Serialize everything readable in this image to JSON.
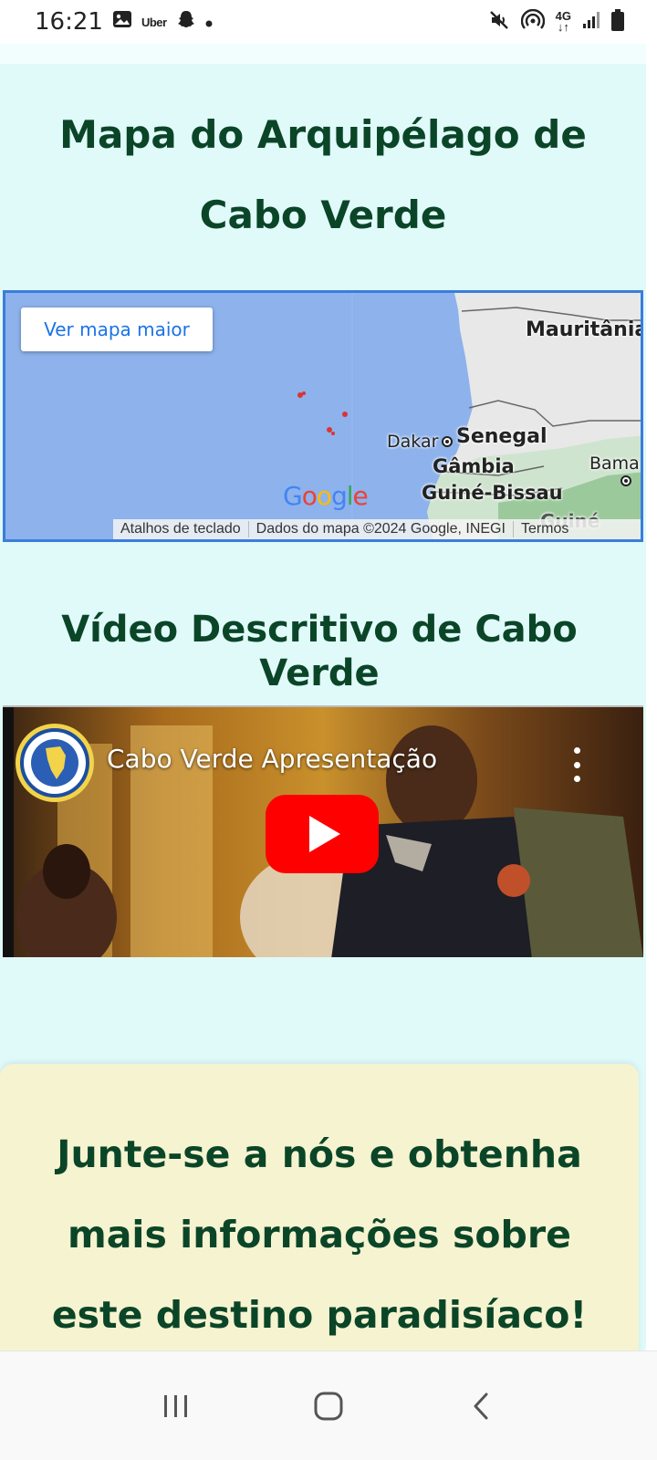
{
  "status_bar": {
    "time": "16:21",
    "left_icons": [
      "image-icon",
      "uber-icon",
      "snapchat-icon",
      "dot-icon"
    ],
    "uber_label": "Uber",
    "network_label": "4G",
    "right_icons": [
      "mute-icon",
      "hotspot-icon",
      "network-4g-icon",
      "signal-icon",
      "battery-icon"
    ]
  },
  "map_section": {
    "title": "Mapa do Arquipélago de Cabo Verde",
    "view_larger_button": "Ver mapa maior",
    "labels": {
      "mauritania": "Mauritânia",
      "dakar": "Dakar",
      "senegal": "Senegal",
      "gambia": "Gâmbia",
      "guinea_bissau": "Guiné-Bissau",
      "bamako": "Bama",
      "guinea": "Guiné"
    },
    "google_logo": "Google",
    "footer": {
      "shortcuts": "Atalhos de teclado",
      "data": "Dados do mapa ©2024 Google, INEGI",
      "terms": "Termos"
    }
  },
  "video_section": {
    "title": "Vídeo Descritivo de Cabo Verde",
    "video_title": "Cabo Verde Apresentação"
  },
  "cta": {
    "text": "Junte-se a nós e obtenha mais informações sobre este destino paradisíaco!"
  },
  "colors": {
    "page_bg": "#e0fafa",
    "heading": "#0b4528",
    "cta_bg": "#f6f3d0",
    "map_water": "#8db2ec",
    "map_border": "#3b7ddd",
    "link_blue": "#1a73e8",
    "yt_red": "#ff0000"
  }
}
